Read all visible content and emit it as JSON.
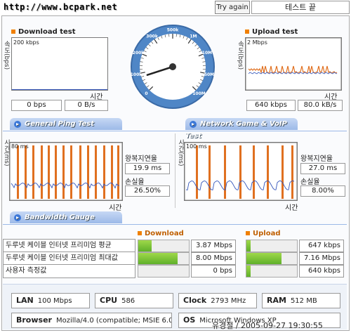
{
  "header": {
    "url": "http://www.bcpark.net",
    "try_again": "Try again",
    "status": "테스트 끝"
  },
  "download": {
    "title": "Download test",
    "ylabel": "속도(bps)",
    "scale": "200 kbps",
    "xlabel": "시간",
    "bps": "0 bps",
    "Bps": "0 B/s"
  },
  "upload": {
    "title": "Upload test",
    "ylabel": "속도(bps)",
    "scale": "2 Mbps",
    "xlabel": "시간",
    "bps": "640 kbps",
    "Bps": "80.0 kB/s"
  },
  "speedometer": {
    "ticks": [
      "0",
      "100k",
      "200k",
      "300k",
      "500k",
      "1M",
      "10M",
      "50M",
      "100M"
    ]
  },
  "tabs": {
    "ping": "General Ping Test",
    "game": "Network Game & VoIP Test",
    "bandwidth": "Bandwidth Gauge"
  },
  "ping": {
    "ylabel": "시간(ms)",
    "scale": "80 ms",
    "xlabel": "시간",
    "rtt_label": "왕복지연율",
    "rtt_value": "19.9 ms",
    "loss_label": "손실율",
    "loss_value": "26.50%"
  },
  "game": {
    "ylabel": "시간(ms)",
    "scale": "100 ms",
    "xlabel": "시간",
    "rtt_label": "왕복지연율",
    "rtt_value": "27.0 ms",
    "loss_label": "손실율",
    "loss_value": "8.00%"
  },
  "bandwidth": {
    "download_header": "Download",
    "upload_header": "Upload",
    "rows": [
      {
        "label": "두루넷 케이블 인터넷 프리미엄 평균",
        "down": "3.87 Mbps",
        "down_fill": 0.26,
        "up": "647 kbps",
        "up_fill": 0.09
      },
      {
        "label": "두루넷 케이블 인터넷 프리미엄 최대값",
        "down": "8.00 Mbps",
        "down_fill": 0.78,
        "up": "7.16 Mbps",
        "up_fill": 0.7
      },
      {
        "label": "사용자 측정값",
        "down": "0 bps",
        "down_fill": 0,
        "up": "640 kbps",
        "up_fill": 0.09
      }
    ]
  },
  "system": {
    "lan_label": "LAN",
    "lan": "100 Mbps",
    "cpu_label": "CPU",
    "cpu": "586",
    "clock_label": "Clock",
    "clock": "2793 MHz",
    "ram_label": "RAM",
    "ram": "512 MB",
    "browser_label": "Browser",
    "browser": "Mozilla/4.0 (compatible; MSIE 6.0",
    "os_label": "OS",
    "os": "Microsoft Windows XP"
  },
  "watermark": "유경철 / 2005-09-27 19:30:55",
  "colors": {
    "tab": "#9cb9e8",
    "bar": "#6cbf2e",
    "spike": "#e07020",
    "line": "#3355bb",
    "accent": "#f08000"
  }
}
